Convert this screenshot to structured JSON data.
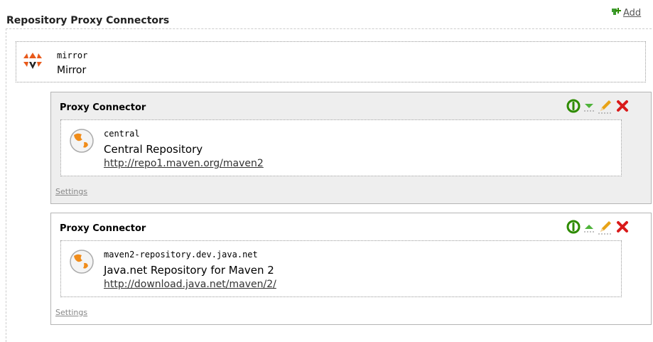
{
  "header": {
    "title": "Repository Proxy Connectors",
    "add_label": "Add"
  },
  "repository": {
    "id": "mirror",
    "name": "Mirror",
    "icon": "archiva-logo-icon"
  },
  "connectors": [
    {
      "heading": "Proxy Connector",
      "id": "central",
      "name": "Central Repository",
      "url": "http://repo1.maven.org/maven2",
      "settings_label": "Settings",
      "move_icon": "move-down-icon",
      "highlighted": true
    },
    {
      "heading": "Proxy Connector",
      "id": "maven2-repository.dev.java.net",
      "name": "Java.net Repository for Maven 2",
      "url": "http://download.java.net/maven/2/",
      "settings_label": "Settings",
      "move_icon": "move-up-icon",
      "highlighted": false
    }
  ],
  "colors": {
    "enable_green": "#2e8b00",
    "delete_red": "#d91a1a",
    "edit_pencil": "#e8a317",
    "highlight_bg": "#eeeeee",
    "globe_orange": "#f08c1a"
  }
}
